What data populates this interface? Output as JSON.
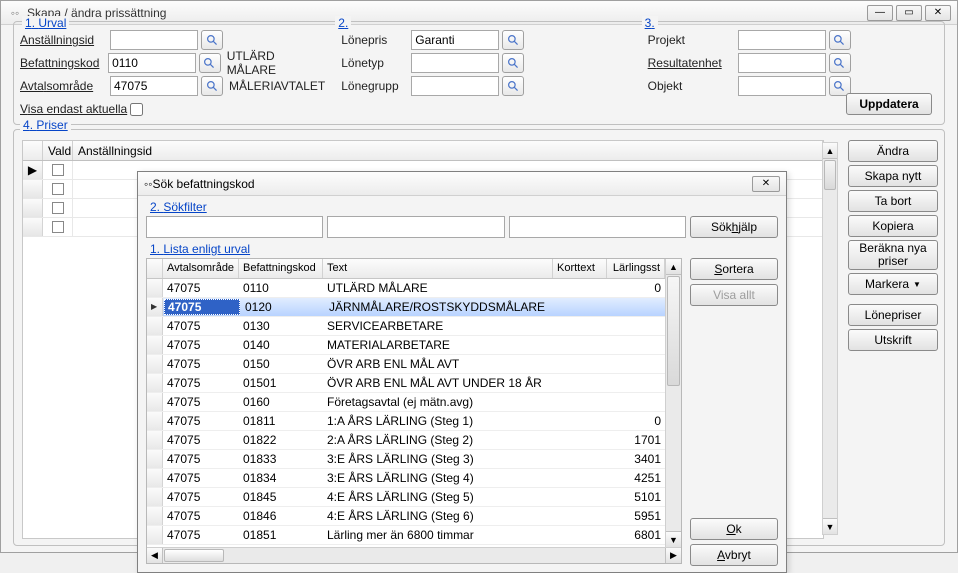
{
  "window": {
    "title": "Skapa / ändra prissättning"
  },
  "sections": {
    "n1": "1",
    "urval": "Urval",
    "n2": "2",
    "n3": "3",
    "n4": "4",
    "priser": "Priser"
  },
  "urval": {
    "anstallningsid_lbl": "nställningsid",
    "anstallningsid_u": "A",
    "anstallningsid_val": "",
    "befattningskod_lbl": "efattningskod",
    "befattningskod_u": "B",
    "befattningskod_val": "0110",
    "befattningskod_desc": "UTLÄRD MÅLARE",
    "avtalsomrade_lbl": "Avta",
    "avtalsomrade_u": "l",
    "avtalsomrade_lbl2": "sområde",
    "avtalsomrade_val": "47075",
    "avtalsomrade_desc": "MÅLERIAVTALET",
    "visa_lbl": "isa endast aktuella",
    "visa_u": "V"
  },
  "col2": {
    "lonepris_lbl": "Lönepris",
    "lonepris_val": "Garanti",
    "lonetyp_lbl": "Lönetyp",
    "lonegrupp_lbl": "Lönegrupp"
  },
  "col3": {
    "projekt_lbl": "Projekt",
    "resultatenhet_lbl": "esultatenhet",
    "resultatenhet_u": "R",
    "objekt_lbl": "Objekt"
  },
  "buttons": {
    "uppdatera": "Uppdatera",
    "andra": "Ändra",
    "skapa": "Skapa nytt",
    "tabort": "Ta bort",
    "kopiera": "Kopiera",
    "berakna": "Beräkna nya priser",
    "markera": "Markera",
    "lonepriser": "Lönepriser",
    "utskrift": "Utskrift"
  },
  "bglist": {
    "vald": "Vald",
    "anst": "Anställningsid"
  },
  "dialog": {
    "title": "Sök befattningskod",
    "sokfilter_no": "2.",
    "sokfilter": "Sökfilter",
    "sokhjalp": "Sökhjälp",
    "lista_no": "1.",
    "lista": "Lista enligt urval",
    "headers": {
      "avtals": "Avtalsområde",
      "bef": "Befattningskod",
      "text": "Text",
      "kort": "Korttext",
      "larl": "Lärlingsst"
    },
    "sortera": "Sortera",
    "visaallt": "Visa allt",
    "ok": "Ok",
    "avbryt": "Avbryt",
    "rows": [
      {
        "avt": "47075",
        "bef": "0110",
        "text": "UTLÄRD MÅLARE",
        "kort": "",
        "larl": "0"
      },
      {
        "avt": "47075",
        "bef": "0120",
        "text": "JÄRNMÅLARE/ROSTSKYDDSMÅLARE",
        "kort": "",
        "larl": ""
      },
      {
        "avt": "47075",
        "bef": "0130",
        "text": "SERVICEARBETARE",
        "kort": "",
        "larl": ""
      },
      {
        "avt": "47075",
        "bef": "0140",
        "text": "MATERIALARBETARE",
        "kort": "",
        "larl": ""
      },
      {
        "avt": "47075",
        "bef": "0150",
        "text": "ÖVR ARB ENL MÅL AVT",
        "kort": "",
        "larl": ""
      },
      {
        "avt": "47075",
        "bef": "01501",
        "text": "ÖVR ARB ENL MÅL AVT UNDER 18 ÅR",
        "kort": "",
        "larl": ""
      },
      {
        "avt": "47075",
        "bef": "0160",
        "text": "Företagsavtal (ej mätn.avg)",
        "kort": "",
        "larl": ""
      },
      {
        "avt": "47075",
        "bef": "01811",
        "text": "1:A ÅRS LÄRLING (Steg 1)",
        "kort": "",
        "larl": "0"
      },
      {
        "avt": "47075",
        "bef": "01822",
        "text": "2:A ÅRS LÄRLING (Steg 2)",
        "kort": "",
        "larl": "1701"
      },
      {
        "avt": "47075",
        "bef": "01833",
        "text": "3:E ÅRS LÄRLING (Steg 3)",
        "kort": "",
        "larl": "3401"
      },
      {
        "avt": "47075",
        "bef": "01834",
        "text": "3:E ÅRS LÄRLING (Steg 4)",
        "kort": "",
        "larl": "4251"
      },
      {
        "avt": "47075",
        "bef": "01845",
        "text": "4:E ÅRS LÄRLING (Steg 5)",
        "kort": "",
        "larl": "5101"
      },
      {
        "avt": "47075",
        "bef": "01846",
        "text": "4:E ÅRS LÄRLING (Steg 6)",
        "kort": "",
        "larl": "5951"
      },
      {
        "avt": "47075",
        "bef": "01851",
        "text": "Lärling mer än 6800 timmar",
        "kort": "",
        "larl": "6801"
      }
    ],
    "selected": 1
  }
}
